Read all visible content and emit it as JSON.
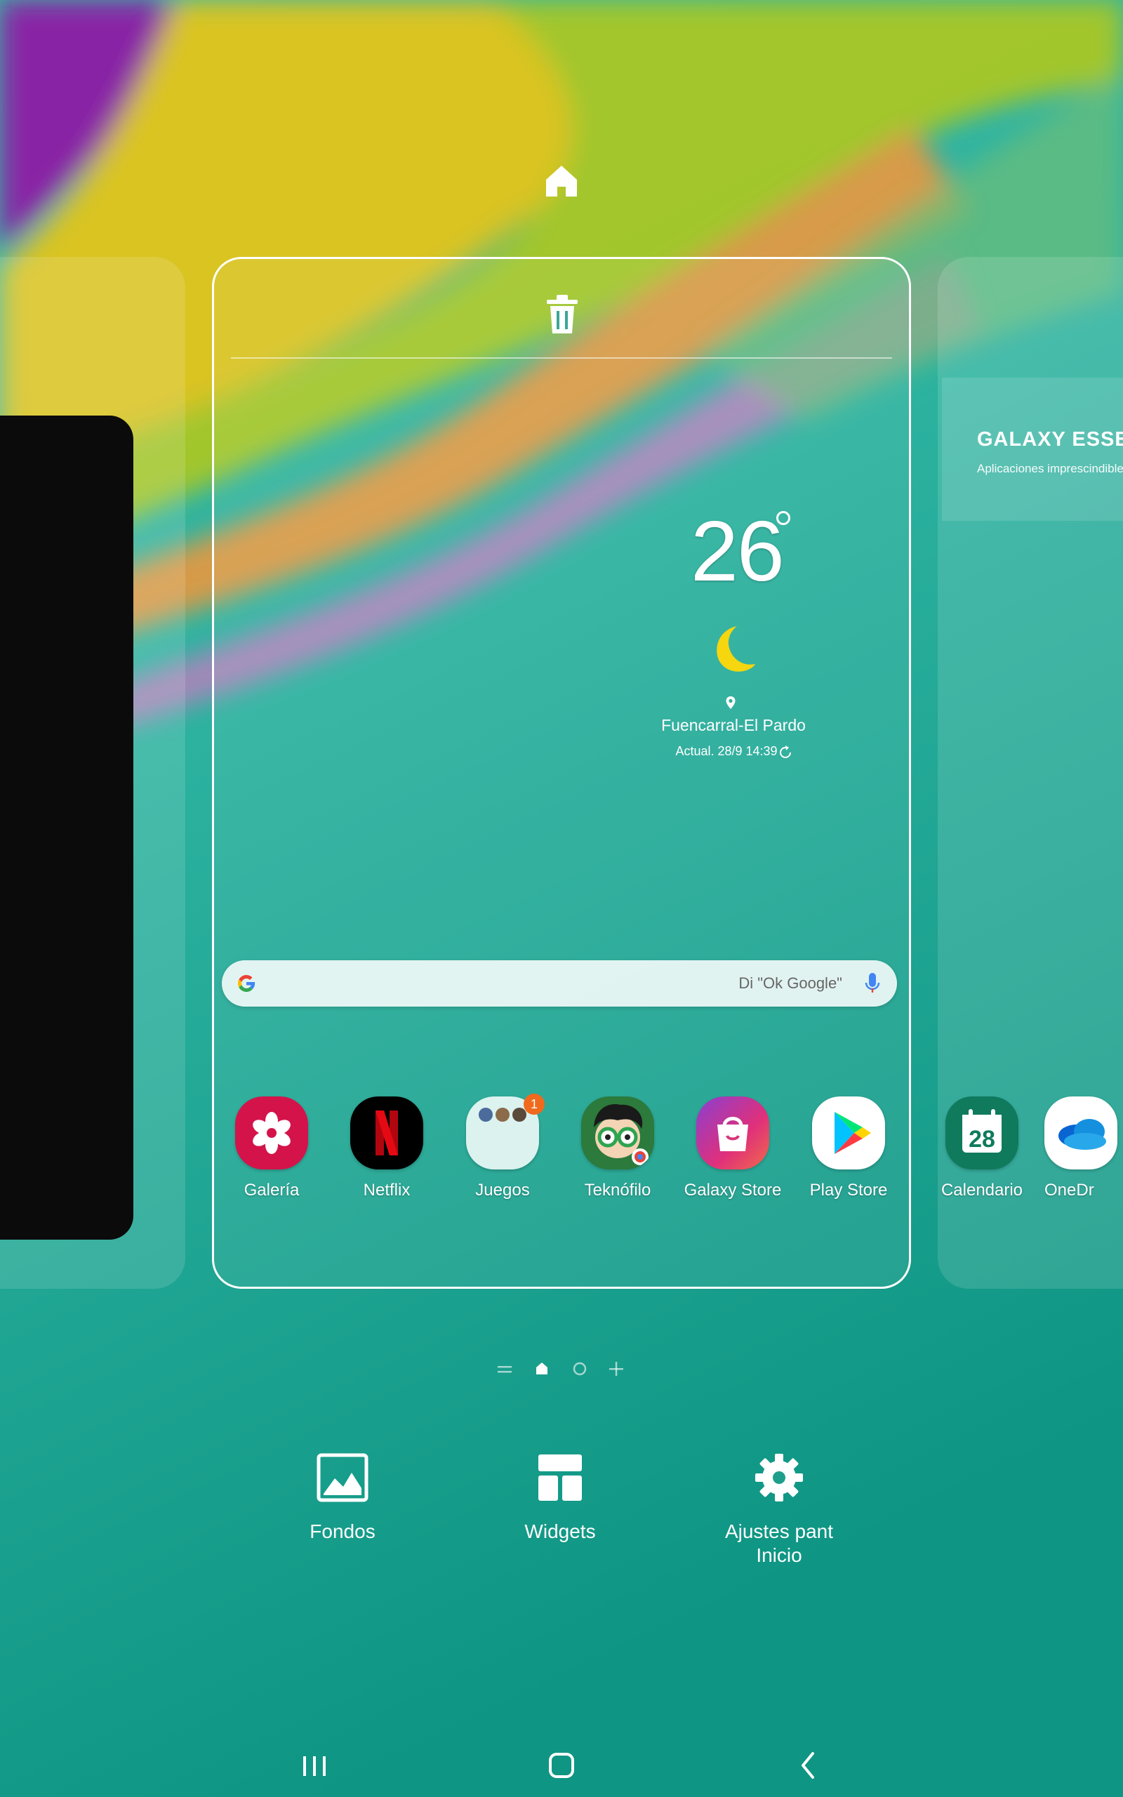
{
  "left_panel": {},
  "right_panel": {
    "essentials_title": "GALAXY ESSENT",
    "essentials_subtitle": "Aplicaciones imprescindibles dise",
    "apps": [
      {
        "label": "Calendario",
        "icon": "calendar-icon",
        "day": "28"
      },
      {
        "label": "OneDr",
        "icon": "onedrive-icon"
      }
    ]
  },
  "weather": {
    "temperature": "26",
    "condition_icon": "moon-icon",
    "location": "Fuencarral-El Pardo",
    "updated": "Actual. 28/9 14:39"
  },
  "search": {
    "hint": "Di \"Ok Google\""
  },
  "apps": [
    {
      "label": "Galería",
      "icon": "gallery-icon"
    },
    {
      "label": "Netflix",
      "icon": "netflix-icon"
    },
    {
      "label": "Juegos",
      "icon": "games-folder-icon",
      "badge": "1"
    },
    {
      "label": "Teknófilo",
      "icon": "teknofilo-icon"
    },
    {
      "label": "Galaxy Store",
      "icon": "galaxy-store-icon"
    },
    {
      "label": "Play Store",
      "icon": "play-store-icon"
    }
  ],
  "tools": [
    {
      "label": "Fondos",
      "icon": "wallpaper-icon"
    },
    {
      "label": "Widgets",
      "icon": "widgets-icon"
    },
    {
      "label": "Ajustes pant\nInicio",
      "icon": "settings-gear-icon"
    }
  ],
  "colors": {
    "netflix_red": "#e50914",
    "gallery_red": "#d4134a",
    "calendar_green": "#0f7a5c",
    "badge_orange": "#f06a1e",
    "accent_teal": "#13a08f"
  }
}
